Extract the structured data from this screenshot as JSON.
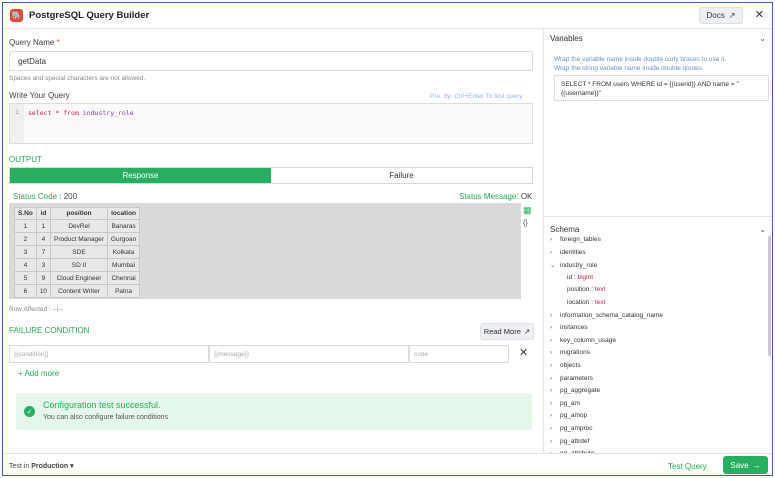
{
  "header": {
    "title": "PostgreSQL Query Builder",
    "docs_label": "Docs",
    "close_icon": "close-icon",
    "logo_icon": "postgres-icon"
  },
  "query_name": {
    "label": "Query Name",
    "required_mark": "*",
    "value": "getData",
    "hint": "Spaces and special characters are not allowed."
  },
  "query_editor": {
    "label": "Write Your Query",
    "shortcut_hint": "Pre. tty:  Ctrl+Enter  To test query",
    "line_number": "1",
    "code_keyword": "select * from",
    "code_table": "industry_role"
  },
  "output": {
    "label": "OUTPUT",
    "tabs": [
      "Response",
      "Failure"
    ],
    "active_tab": 0,
    "status_code_label": "Status Code :",
    "status_code": "200",
    "status_message_label": "Status Message:",
    "status_message": "OK",
    "table": {
      "columns": [
        "S.No",
        "id",
        "position",
        "location"
      ],
      "rows": [
        [
          "1",
          "1",
          "DevRel",
          "Banaras"
        ],
        [
          "2",
          "4",
          "Product Manager",
          "Gurgoan"
        ],
        [
          "3",
          "7",
          "SDE",
          "Kolkata"
        ],
        [
          "4",
          "3",
          "SD II",
          "Mumbai"
        ],
        [
          "5",
          "9",
          "Cloud Engineer",
          "Chennai"
        ],
        [
          "6",
          "10",
          "Content Writer",
          "Patna"
        ]
      ]
    },
    "rows_affected": "Row Affected : --|--"
  },
  "failure_condition": {
    "label": "FAILURE CONDITION",
    "read_more": "Read More",
    "placeholders": {
      "condition": "{{condition}}",
      "message": "{{message}}",
      "code": "code"
    },
    "add_more": "+ Add more"
  },
  "success": {
    "title": "Configuration test successful.",
    "subtitle": "You can also configure failure conditions"
  },
  "footer": {
    "test_in_label": "Test in",
    "test_in_value": "Production",
    "test_query": "Test Query",
    "save": "Save"
  },
  "variables": {
    "title": "Variables",
    "hint_line1": "Wrap the variable name inside double curly braces to use it.",
    "hint_line2": "Wrap the string variable name inside double qoutes.",
    "example": "SELECT * FROM users WHERE id = {{userid}} AND name = \"{{username}}\""
  },
  "schema": {
    "title": "Schema",
    "items": [
      "foreign_tables",
      "identities",
      "industry_role",
      "information_schema_catalog_name",
      "instances",
      "key_column_usage",
      "migrations",
      "objects",
      "parameters",
      "pg_aggregate",
      "pg_am",
      "pg_amop",
      "pg_amproc",
      "pg_attrdef",
      "pg_attribute"
    ],
    "expanded": "industry_role",
    "columns": [
      {
        "name": "id",
        "type": "bigint"
      },
      {
        "name": "position",
        "type": "text"
      },
      {
        "name": "location",
        "type": "text"
      }
    ]
  },
  "colors": {
    "accent": "#27ae60",
    "error": "#e0493e"
  }
}
